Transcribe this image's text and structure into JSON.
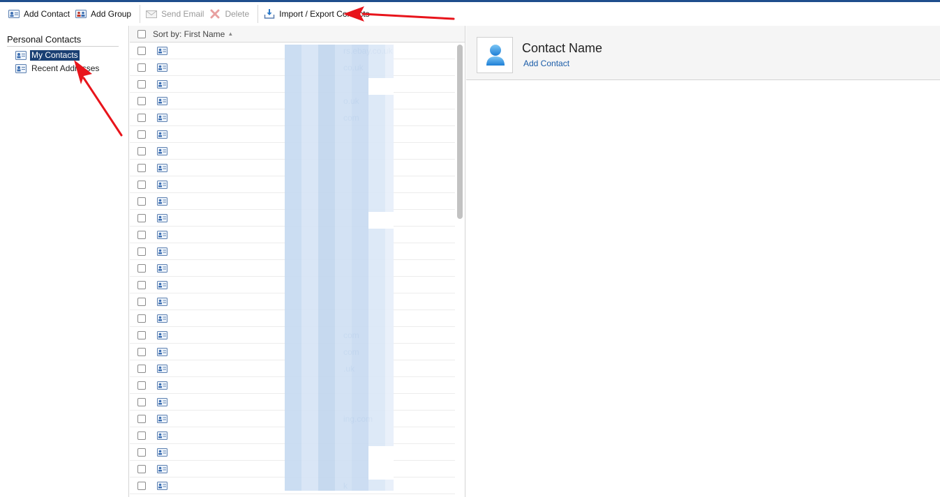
{
  "toolbar": {
    "add_contact": "Add Contact",
    "add_group": "Add Group",
    "send_email": "Send Email",
    "delete": "Delete",
    "import_export": "Import / Export Contacts"
  },
  "left_panel": {
    "title": "Personal Contacts",
    "items": [
      {
        "label": "My Contacts",
        "selected": true
      },
      {
        "label": "Recent Addresses",
        "selected": false
      }
    ]
  },
  "list": {
    "sort_label": "Sort by: First Name",
    "visible_emails": [
      "rs.ebay.co.uk",
      "co.uk",
      "",
      "o.uk",
      "com",
      "",
      "",
      "",
      "",
      "",
      "",
      "",
      "",
      "",
      "",
      "",
      "",
      "com",
      "com",
      ".uk",
      "",
      "",
      "ing.com",
      "",
      "",
      "",
      "k"
    ]
  },
  "detail": {
    "contact_name": "Contact Name",
    "add_contact_link": "Add Contact"
  },
  "colors": {
    "accent": "#1a3f73",
    "link": "#1a5ca8",
    "annotation_arrow": "#e8141b"
  }
}
